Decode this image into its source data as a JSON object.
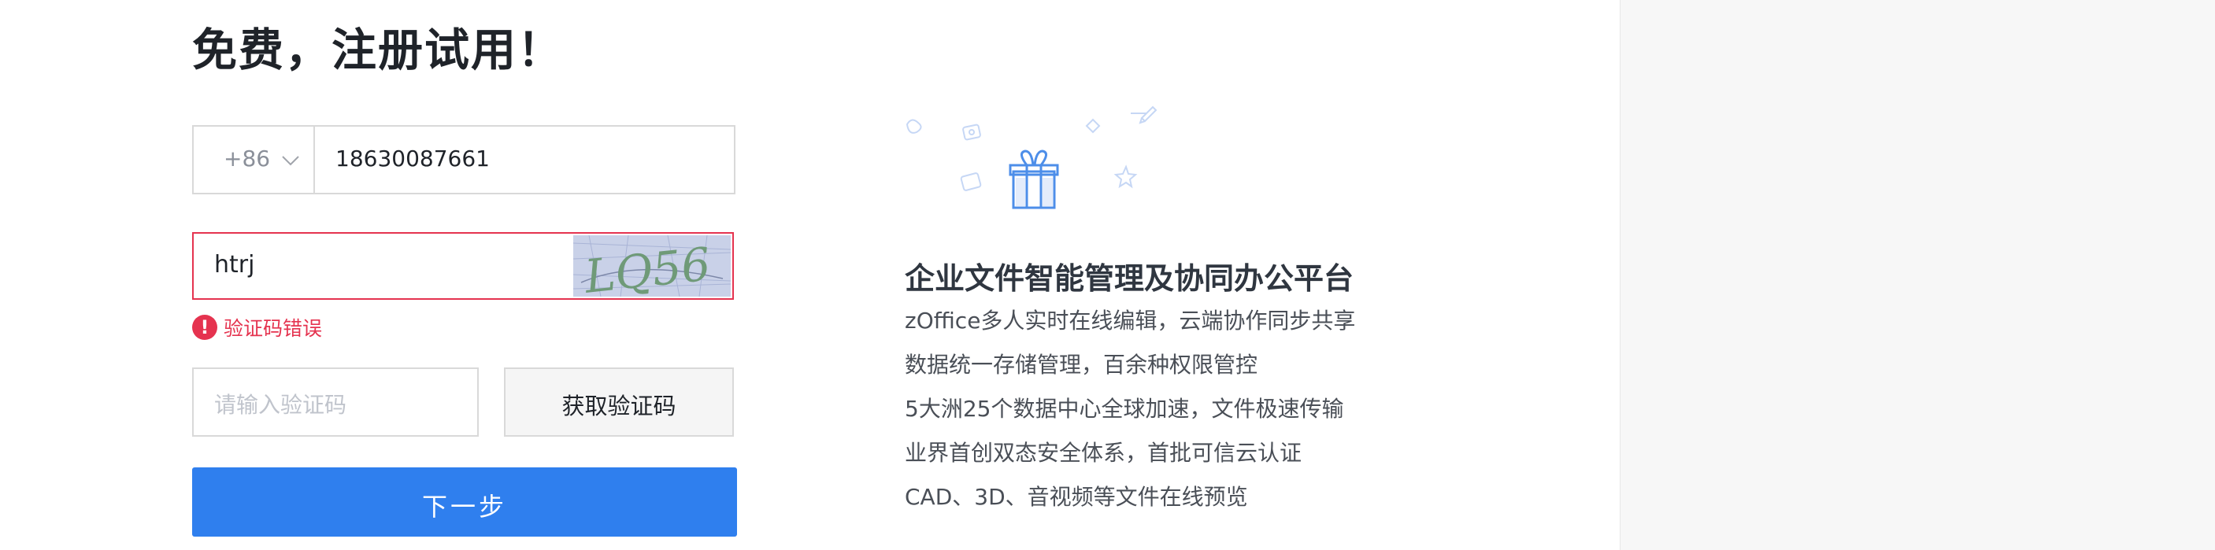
{
  "page": {
    "title": "免费，注册试用！"
  },
  "form": {
    "country_code": "+86",
    "phone_value": "18630087661",
    "captcha_value": "htrj",
    "captcha_image_text": "LQ56",
    "error_text": "验证码错误",
    "code_placeholder": "请输入验证码",
    "get_code_label": "获取验证码",
    "next_label": "下一步"
  },
  "features": {
    "title": "企业文件智能管理及协同办公平台",
    "items": [
      "zOffice多人实时在线编辑，云端协作同步共享",
      "数据统一存储管理，百余种权限管控",
      "5大洲25个数据中心全球加速，文件极速传输",
      "业界首创双态安全体系，首批可信云认证",
      "CAD、3D、音视频等文件在线预览"
    ]
  },
  "colors": {
    "primary": "#2f7fee",
    "error": "#e5334f",
    "border": "#d9d9d9",
    "right_panel_bg": "#f7f7f7"
  },
  "icons": {
    "country_dropdown": "chevron-down-icon",
    "error": "exclamation-circle-icon",
    "illustration": "gift-icon"
  }
}
